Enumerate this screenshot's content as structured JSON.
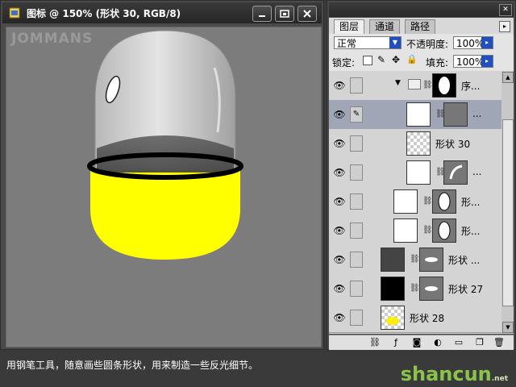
{
  "document": {
    "title": "图标 @ 150% (形状 30, RGB/8)",
    "watermark": "JOMMANS",
    "controls": [
      "minimize-icon",
      "restore-icon",
      "close-icon"
    ]
  },
  "layers_panel": {
    "tabs": [
      {
        "label": "图层",
        "active": true
      },
      {
        "label": "通道",
        "active": false
      },
      {
        "label": "路径",
        "active": false
      }
    ],
    "blend_mode": "正常",
    "opacity_label": "不透明度:",
    "opacity_value": "100%",
    "lock_label": "锁定:",
    "fill_label": "填充:",
    "fill_value": "100%",
    "layers": [
      {
        "name": "序...",
        "type": "group",
        "selected": false
      },
      {
        "name": "...",
        "type": "shape",
        "selected": true
      },
      {
        "name": "形状 30",
        "type": "shape",
        "selected": false
      },
      {
        "name": "...",
        "type": "shape",
        "selected": false
      },
      {
        "name": "形...",
        "type": "shape",
        "selected": false
      },
      {
        "name": "形...",
        "type": "shape",
        "selected": false
      },
      {
        "name": "形状 ...",
        "type": "shape",
        "selected": false
      },
      {
        "name": "形状 27",
        "type": "shape",
        "selected": false
      },
      {
        "name": "形状 28",
        "type": "shape",
        "selected": false
      }
    ],
    "footer_icons": [
      "link-icon",
      "fx-icon",
      "mask-icon",
      "adjustment-icon",
      "folder-icon",
      "new-layer-icon",
      "trash-icon"
    ]
  },
  "caption": "用钢笔工具，随意画些圆条形状，用来制造一些反光细节。",
  "brand": {
    "main": "shancun",
    "sub": ".net"
  },
  "colors": {
    "yellow": "#ffff00",
    "canvas": "#7c7c7c",
    "selected_row": "#a0a6b5"
  }
}
